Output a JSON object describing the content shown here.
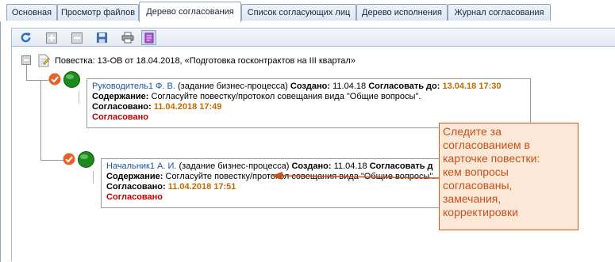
{
  "tabs": [
    {
      "label": "Основная",
      "active": false
    },
    {
      "label": "Просмотр файлов",
      "active": false
    },
    {
      "label": "Дерево согласования",
      "active": true
    },
    {
      "label": "Список согласующих лиц",
      "active": false
    },
    {
      "label": "Дерево исполнения",
      "active": false
    },
    {
      "label": "Журнал согласования",
      "active": false
    }
  ],
  "toolbar": {
    "buttons": [
      "refresh-icon",
      "expand-all-icon",
      "collapse-all-icon",
      "save-icon",
      "print-icon",
      "purple-document-icon"
    ]
  },
  "tree": {
    "root": {
      "title": "Повестка: 13-ОВ от 18.04.2018, «Подготовка госконтрактов на III квартал»"
    },
    "nodes": [
      {
        "person": "Руководитель1 Ф. В.",
        "task_type": "(задание бизнес-процесса)",
        "created_label": "Создано:",
        "created_value": "11.04.18",
        "due_label": "Согласовать до:",
        "due_value": "13.04.18 17:30",
        "content_label": "Содержание:",
        "content_value": "Согласуйте повестку/протокол совещания вида \"Общие вопросы\".",
        "approved_label": "Согласовано:",
        "approved_value": "11.04.2018 17:49",
        "status": "Согласовано"
      },
      {
        "person": "Начальник1 А. И.",
        "task_type": "(задание бизнес-процесса)",
        "created_label": "Создано:",
        "created_value": "11.04.18",
        "due_label": "Согласовать д",
        "content_label": "Содержание:",
        "content_value": "Согласуйте повестку/протокол совещания вида \"Общие вопросы\".",
        "approved_label": "Согласовано:",
        "approved_value": "11.04.2018 17:51",
        "status": "Согласовано"
      }
    ]
  },
  "callout": {
    "lines": [
      "Следите за",
      "согласованием в",
      "карточке повестки:",
      "кем вопросы",
      "согласованы,",
      "замечания,",
      "корректировки"
    ]
  },
  "colors": {
    "accent_orange": "#c8501a",
    "due_orange": "#c46a00",
    "status_red": "#c00000",
    "link_blue": "#1a55a6"
  }
}
